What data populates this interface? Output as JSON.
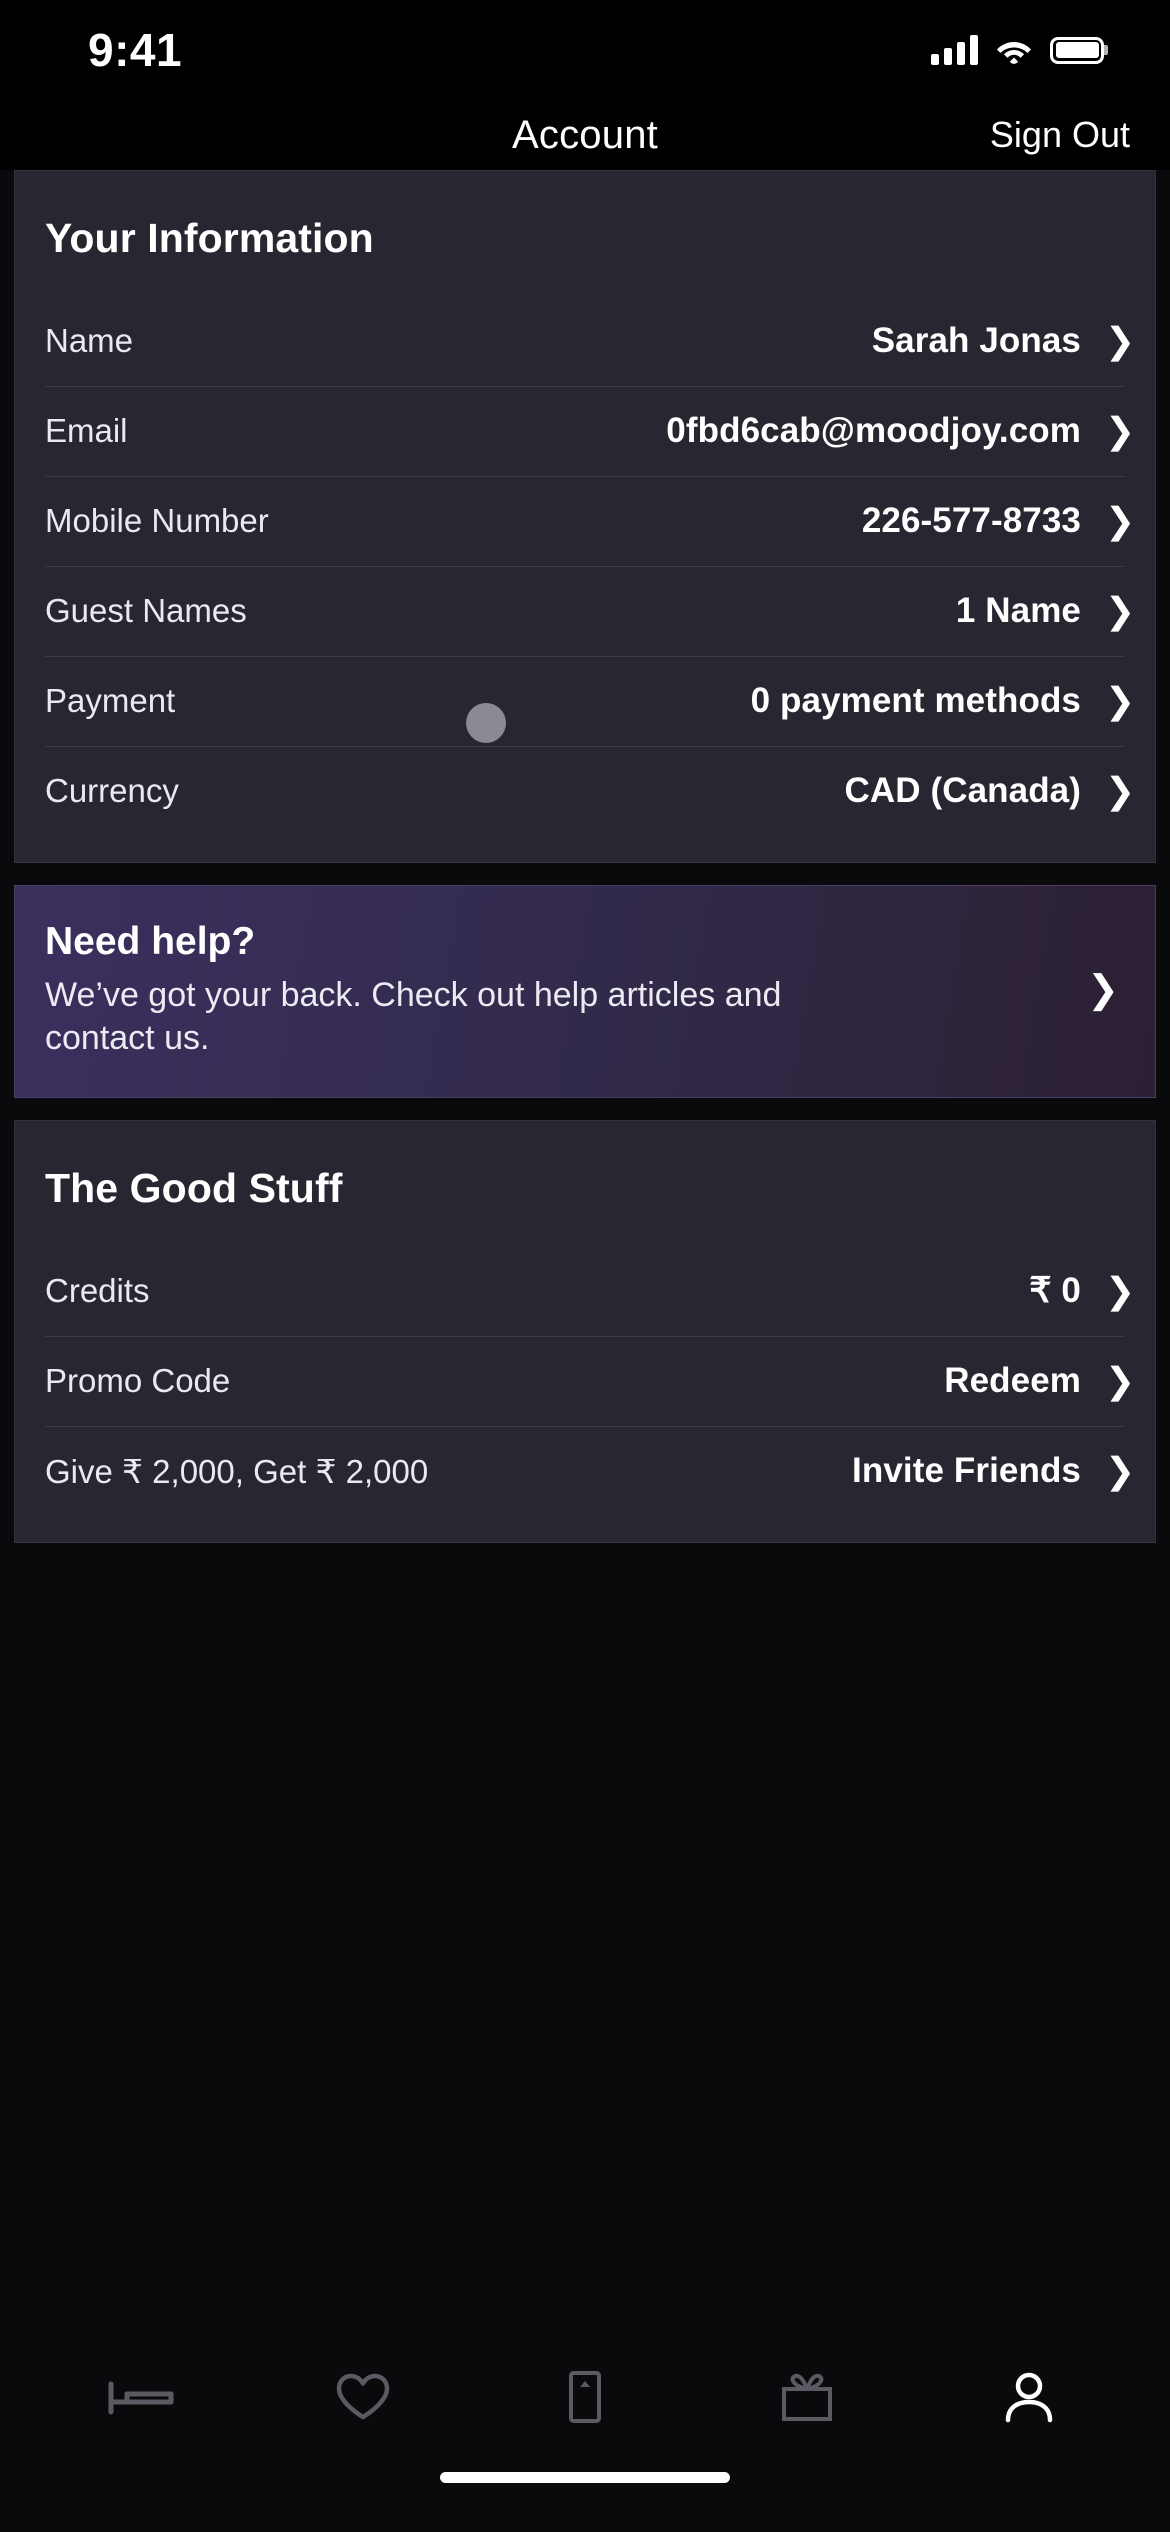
{
  "status_bar": {
    "time": "9:41",
    "icons": [
      "cellular-signal-icon",
      "wifi-icon",
      "battery-icon"
    ]
  },
  "nav_bar": {
    "title": "Account",
    "sign_out_label": "Sign Out"
  },
  "your_information": {
    "title": "Your Information",
    "rows": [
      {
        "label": "Name",
        "value": "Sarah Jonas"
      },
      {
        "label": "Email",
        "value": "0fbd6cab@moodjoy.com"
      },
      {
        "label": "Mobile Number",
        "value": "226-577-8733"
      },
      {
        "label": "Guest Names",
        "value": "1 Name"
      },
      {
        "label": "Payment",
        "value": "0 payment methods"
      },
      {
        "label": "Currency",
        "value": "CAD (Canada)"
      }
    ]
  },
  "help_banner": {
    "title": "Need help?",
    "body": "We’ve got your back. Check out help articles and contact us."
  },
  "good_stuff": {
    "title": "The Good Stuff",
    "rows": [
      {
        "label": "Credits",
        "value": "₹ 0"
      },
      {
        "label": "Promo Code",
        "value": "Redeem"
      },
      {
        "label": "Give ₹ 2,000, Get ₹ 2,000",
        "value": "Invite Friends"
      }
    ]
  },
  "tab_bar": {
    "items": [
      {
        "icon": "bed-icon",
        "active": false
      },
      {
        "icon": "heart-icon",
        "active": false
      },
      {
        "icon": "door-icon",
        "active": false
      },
      {
        "icon": "gift-icon",
        "active": false
      },
      {
        "icon": "person-icon",
        "active": true
      }
    ]
  },
  "chevron": "❯",
  "colors": {
    "background": "#0a0a0c",
    "card": "#272732",
    "divider": "#3b3b47",
    "accent_purple": "#3b2f5e",
    "text_primary": "#ffffff",
    "tab_inactive": "#5a5a63"
  }
}
